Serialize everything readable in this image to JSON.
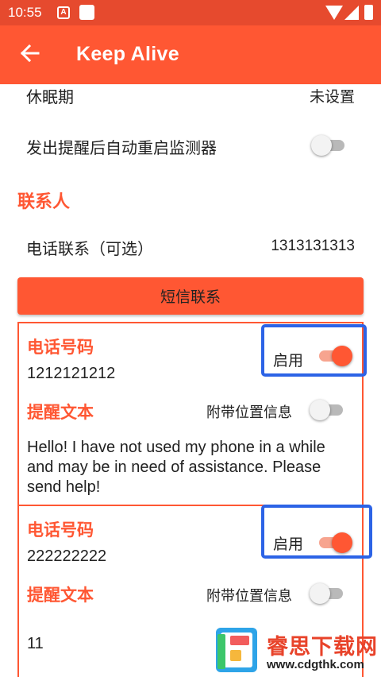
{
  "status_bar": {
    "time": "10:55",
    "notification_icon_letter": "A"
  },
  "app_bar": {
    "title": "Keep Alive",
    "back_icon": "arrow-left-icon",
    "color": "#ff5733"
  },
  "settings": {
    "dormancy_label": "休眠期",
    "dormancy_value": "未设置",
    "auto_restart_label": "发出提醒后自动重启监测器",
    "auto_restart_enabled": false
  },
  "contacts": {
    "header": "联系人",
    "phone_contact_label": "电话联系（可选）",
    "phone_contact_value": "1313131313",
    "sms_button_label": "短信联系"
  },
  "sms_contacts": [
    {
      "phone_label": "电话号码",
      "phone": "1212121212",
      "enable_label": "启用",
      "enabled": true,
      "message_label": "提醒文本",
      "location_label": "附带位置信息",
      "location_enabled": false,
      "message": "Hello! I have not used my phone in a while and may be in need of assistance. Please send help!"
    },
    {
      "phone_label": "电话号码",
      "phone": "222222222",
      "enable_label": "启用",
      "enabled": true,
      "message_label": "提醒文本",
      "location_label": "附带位置信息",
      "location_enabled": false,
      "message": "11"
    }
  ],
  "watermark": {
    "title": "睿思下载网",
    "url": "www.cdgthk.com"
  },
  "colors": {
    "accent": "#ff5733",
    "highlight": "#2c63e6"
  }
}
